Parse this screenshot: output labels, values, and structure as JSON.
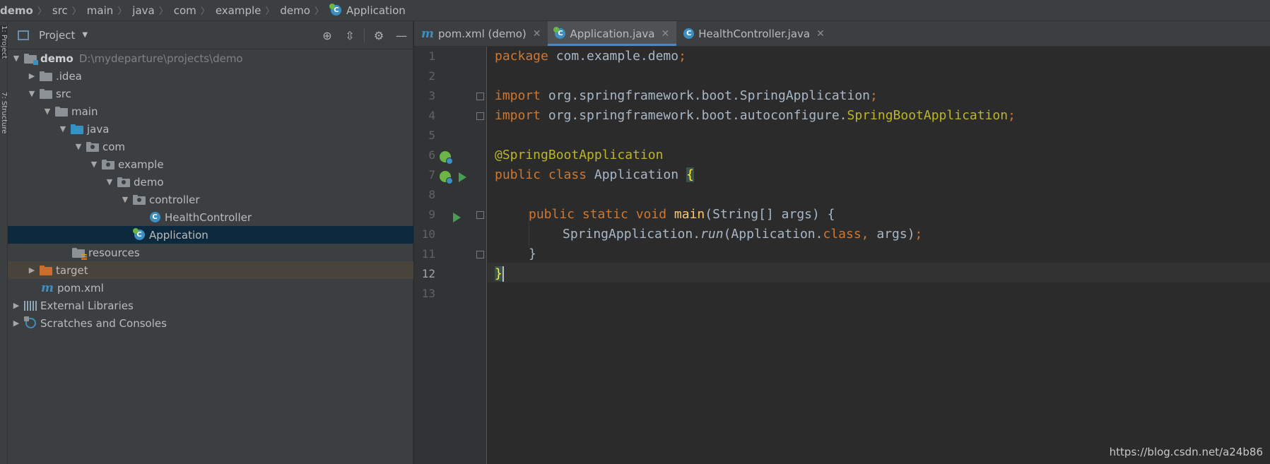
{
  "breadcrumb": {
    "items": [
      "demo",
      "src",
      "main",
      "java",
      "com",
      "example",
      "demo",
      "Application"
    ]
  },
  "tool_strip": {
    "tabs": [
      "1: Project",
      "7: Structure"
    ]
  },
  "project_panel": {
    "title": "Project",
    "tree": {
      "root_name": "demo",
      "root_path": "D:\\mydeparture\\projects\\demo",
      "idea": ".idea",
      "src": "src",
      "main": "main",
      "java": "java",
      "com": "com",
      "example": "example",
      "demo_pkg": "demo",
      "controller": "controller",
      "health_controller": "HealthController",
      "application": "Application",
      "resources": "resources",
      "target": "target",
      "pom": "pom.xml",
      "external_libraries": "External Libraries",
      "scratches": "Scratches and Consoles"
    }
  },
  "editor": {
    "tabs": [
      {
        "label": "pom.xml (demo)",
        "icon": "maven-icon"
      },
      {
        "label": "Application.java",
        "icon": "spring-boot-class-icon"
      },
      {
        "label": "HealthController.java",
        "icon": "class-icon"
      }
    ],
    "active_tab": "Application.java",
    "line_numbers": [
      "1",
      "2",
      "3",
      "4",
      "5",
      "6",
      "7",
      "8",
      "9",
      "10",
      "11",
      "12",
      "13"
    ],
    "current_line": 12,
    "code": {
      "l1_kw": "package",
      "l1_rest": " com.example.demo",
      "l1_semi": ";",
      "l3_kw": "import",
      "l3_rest": " org.springframework.boot.SpringApplication",
      "l3_semi": ";",
      "l4_kw": "import",
      "l4_pkg": " org.springframework.boot.autoconfigure.",
      "l4_cls": "SpringBootApplication",
      "l4_semi": ";",
      "l6_ann": "@SpringBootApplication",
      "l7_kw": "public class",
      "l7_name": " Application ",
      "l7_brace": "{",
      "l9_kw": "public static void",
      "l9_fn": "main",
      "l9_rest": "(String[] args) {",
      "l10_a": "SpringApplication.",
      "l10_run": "run",
      "l10_b": "(Application.",
      "l10_class": "class,",
      "l10_c": " args)",
      "l10_semi": ";",
      "l11": "}",
      "l12": "}"
    }
  },
  "watermark": "https://blog.csdn.net/a24b86",
  "colors": {
    "background": "#2b2b2b",
    "panel": "#3c3f41",
    "keyword": "#cc7832",
    "annotation": "#bbb529",
    "function": "#ffc66d",
    "selection": "#0d293e"
  }
}
